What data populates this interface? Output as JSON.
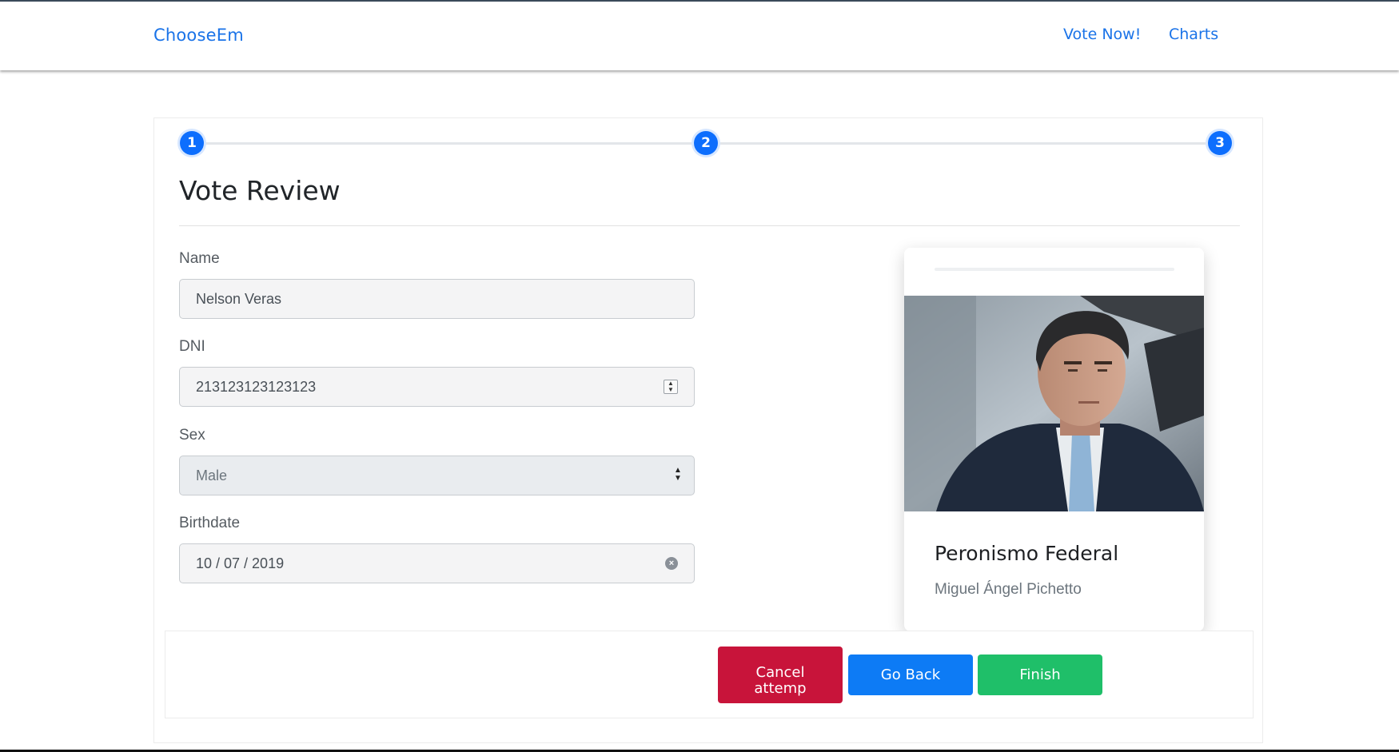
{
  "navbar": {
    "brand": "ChooseEm",
    "links": [
      {
        "label": "Vote Now!"
      },
      {
        "label": "Charts"
      }
    ]
  },
  "stepper": {
    "steps": [
      "1",
      "2",
      "3"
    ]
  },
  "page": {
    "title": "Vote Review"
  },
  "form": {
    "name": {
      "label": "Name",
      "value": "Nelson Veras"
    },
    "dni": {
      "label": "DNI",
      "value": "213123123123123"
    },
    "sex": {
      "label": "Sex",
      "value": "Male"
    },
    "birthdate": {
      "label": "Birthdate",
      "value": "10 / 07 / 2019"
    }
  },
  "party_card": {
    "party": "Peronismo Federal",
    "candidate": "Miguel Ángel Pichetto"
  },
  "actions": {
    "cancel_line1": "Cancel",
    "cancel_line2": "attemp",
    "back": "Go Back",
    "finish": "Finish"
  },
  "colors": {
    "primary": "#0d7bf5",
    "danger": "#c8143a",
    "success": "#1fbf69",
    "link": "#1a73e8"
  }
}
